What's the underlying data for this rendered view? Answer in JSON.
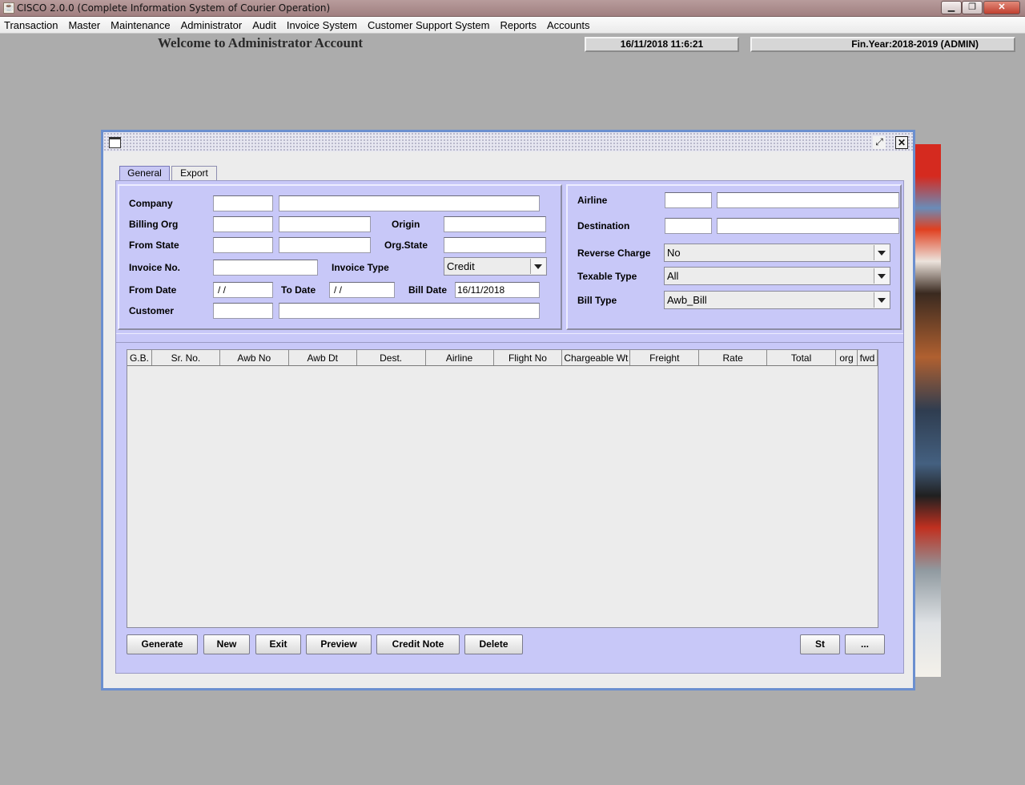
{
  "os_window": {
    "title": "CISCO 2.0.0 (Complete Information System of Courier Operation)",
    "minimize": "▁",
    "maximize": "❐",
    "close": "✕"
  },
  "menubar": [
    "Transaction",
    "Master",
    "Maintenance",
    "Administrator",
    "Audit",
    "Invoice System",
    "Customer Support System",
    "Reports",
    "Accounts"
  ],
  "welcome": "Welcome to Administrator Account",
  "status": {
    "datetime": "16/11/2018      11:6:21",
    "fin_year": "Fin.Year:2018-2019  (ADMIN)"
  },
  "frame": {
    "restore_icon": "⤢",
    "close_icon": "✕"
  },
  "tabs": [
    "General",
    "Export"
  ],
  "form": {
    "company_label": "Company",
    "billing_org_label": "Billing Org",
    "origin_label": "Origin",
    "from_state_label": "From State",
    "org_state_label": "Org.State",
    "invoice_no_label": "Invoice No.",
    "invoice_type_label": "Invoice Type",
    "invoice_type_value": "Credit",
    "from_date_label": "From Date",
    "from_date_value": " / /",
    "to_date_label": "To Date",
    "to_date_value": " / /",
    "bill_date_label": "Bill Date",
    "bill_date_value": "16/11/2018",
    "customer_label": "Customer",
    "airline_label": "Airline",
    "destination_label": "Destination",
    "reverse_charge_label": "Reverse Charge",
    "reverse_charge_value": "No",
    "texable_type_label": "Texable Type",
    "texable_type_value": "All",
    "bill_type_label": "Bill Type",
    "bill_type_value": "Awb_Bill"
  },
  "table": {
    "columns": [
      "G.B.",
      "Sr. No.",
      "Awb No",
      "Awb Dt",
      "Dest.",
      "Airline",
      "Flight No",
      "Chargeable Wt",
      "Freight",
      "Rate",
      "Total",
      "org",
      "fwd"
    ]
  },
  "buttons": {
    "generate": "Generate",
    "new": "New",
    "exit": "Exit",
    "preview": "Preview",
    "credit_note": "Credit Note",
    "delete": "Delete",
    "st": "St",
    "more": "..."
  }
}
